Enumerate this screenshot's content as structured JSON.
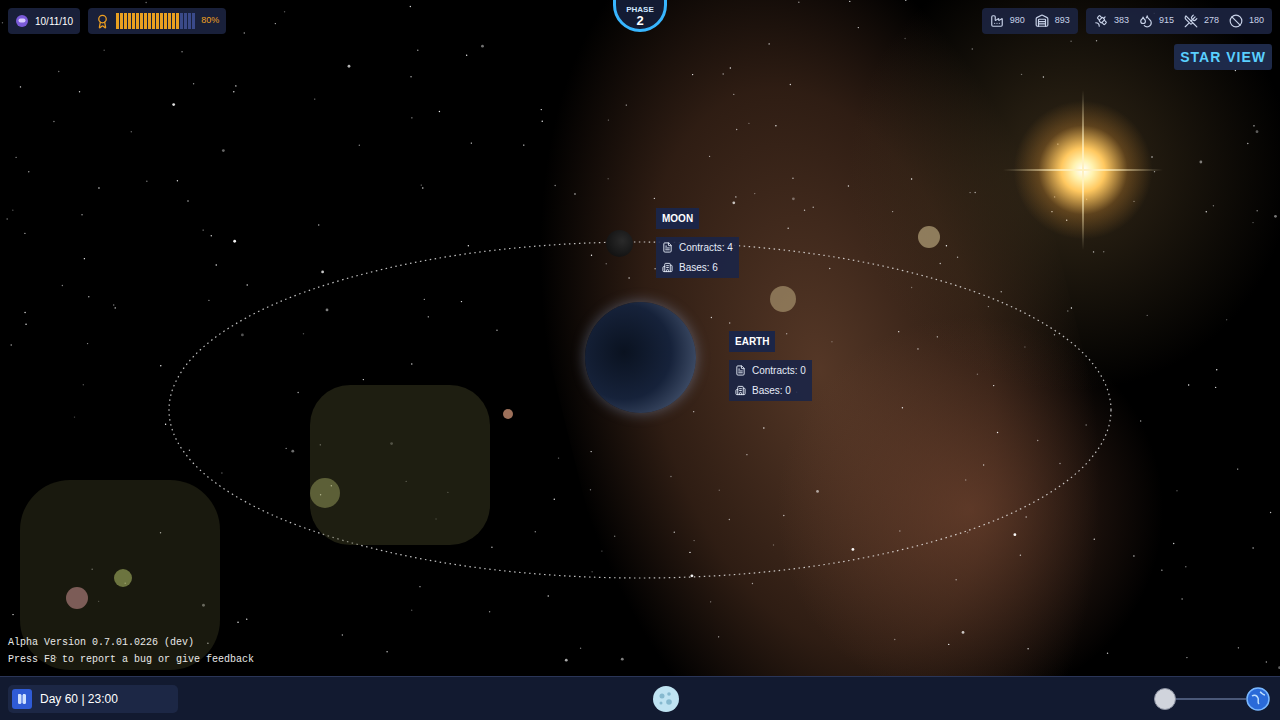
{
  "top_bar": {
    "crew": "10/11/10",
    "morale": {
      "level": 0.8,
      "reading": "80%"
    },
    "phase": {
      "label": "PHASE",
      "number": "2"
    },
    "resource_groups": [
      [
        "980",
        "893"
      ],
      [
        "383",
        "915",
        "278",
        "180"
      ]
    ],
    "star_view_button": "STAR VIEW"
  },
  "bodies": [
    {
      "name": "MOON",
      "contracts": "Contracts: 4",
      "bases": "Bases: 6"
    },
    {
      "name": "EARTH",
      "contracts": "Contracts: 0",
      "bases": "Bases: 0"
    }
  ],
  "version": "Alpha Version 0.7.01.0226 (dev)",
  "feedback_hint": "Press F8 to report a bug or give feedback",
  "bottom_bar": {
    "paused": false,
    "day": "Day 60",
    "separator": "|",
    "time": "23:00",
    "zoom": {
      "level": 0
    }
  }
}
